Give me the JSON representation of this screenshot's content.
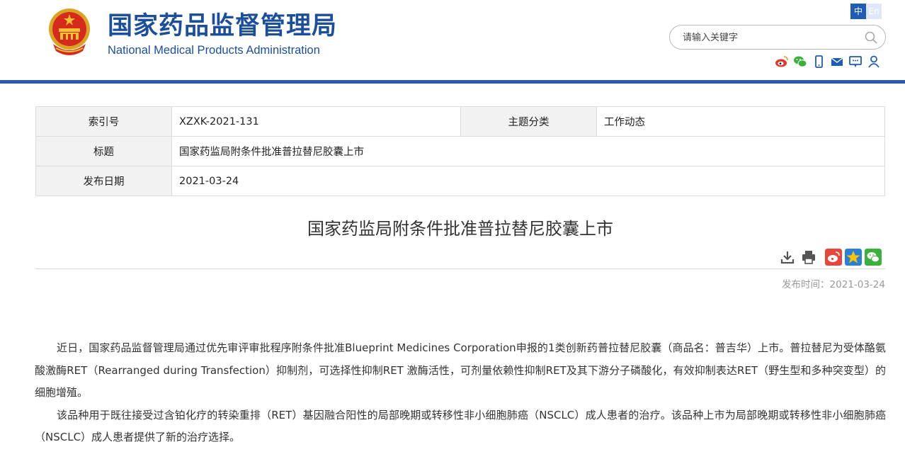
{
  "header": {
    "title_cn": "国家药品监督管理局",
    "title_en": "National Medical Products Administration",
    "lang_zh": "中",
    "lang_en": "En",
    "search_placeholder": "请输入关键字"
  },
  "info": {
    "index_label": "索引号",
    "index_value": "XZXK-2021-131",
    "category_label": "主题分类",
    "category_value": "工作动态",
    "title_label": "标题",
    "title_value": "国家药监局附条件批准普拉替尼胶囊上市",
    "date_label": "发布日期",
    "date_value": "2021-03-24"
  },
  "article": {
    "title": "国家药监局附条件批准普拉替尼胶囊上市",
    "pub_time": "发布时间：2021-03-24",
    "paragraphs": [
      "近日，国家药品监督管理局通过优先审评审批程序附条件批准Blueprint Medicines Corporation申报的1类创新药普拉替尼胶囊（商品名：普吉华）上市。普拉替尼为受体酪氨酸激酶RET（Rearranged during Transfection）抑制剂，可选择性抑制RET 激酶活性，可剂量依赖性抑制RET及其下游分子磷酸化，有效抑制表达RET（野生型和多种突变型）的细胞增殖。",
      "该品种用于既往接受过含铂化疗的转染重排（RET）基因融合阳性的局部晚期或转移性非小细胞肺癌（NSCLC）成人患者的治疗。该品种上市为局部晚期或转移性非小细胞肺癌（NSCLC）成人患者提供了新的治疗选择。"
    ]
  },
  "colors": {
    "brand": "#1b4f9c",
    "bar": "#2a5aa8"
  },
  "icons": {
    "top": [
      "weibo-icon",
      "wechat-icon",
      "mobile-icon",
      "mail-icon",
      "message-icon",
      "user-icon"
    ],
    "tools": [
      "download-icon",
      "print-icon"
    ],
    "share": [
      "weibo-share-icon",
      "qzone-share-icon",
      "wechat-share-icon"
    ]
  }
}
